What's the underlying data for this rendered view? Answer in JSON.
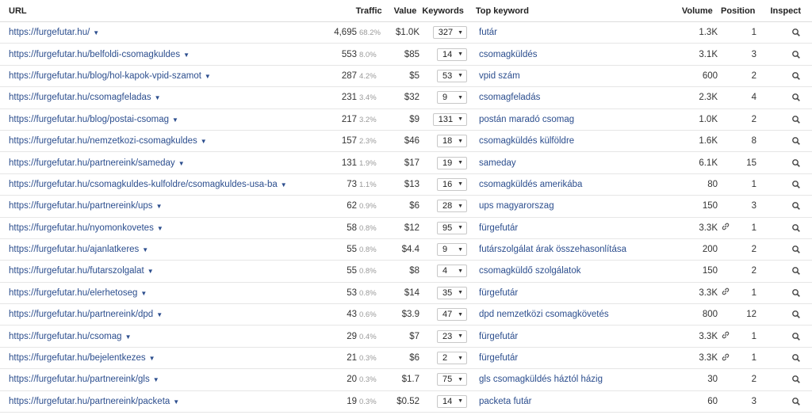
{
  "headers": {
    "url": "URL",
    "traffic": "Traffic",
    "value": "Value",
    "keywords": "Keywords",
    "top_keyword": "Top keyword",
    "volume": "Volume",
    "position": "Position",
    "inspect": "Inspect"
  },
  "rows": [
    {
      "url": "https://furgefutar.hu/",
      "traffic": "4,695",
      "share": "68.2%",
      "value": "$1.0K",
      "keywords": "327",
      "top_keyword": "futár",
      "volume": "1.3K",
      "link": false,
      "position": "1"
    },
    {
      "url": "https://furgefutar.hu/belfoldi-csomagkuldes",
      "traffic": "553",
      "share": "8.0%",
      "value": "$85",
      "keywords": "14",
      "top_keyword": "csomagküldés",
      "volume": "3.1K",
      "link": false,
      "position": "3"
    },
    {
      "url": "https://furgefutar.hu/blog/hol-kapok-vpid-szamot",
      "traffic": "287",
      "share": "4.2%",
      "value": "$5",
      "keywords": "53",
      "top_keyword": "vpid szám",
      "volume": "600",
      "link": false,
      "position": "2"
    },
    {
      "url": "https://furgefutar.hu/csomagfeladas",
      "traffic": "231",
      "share": "3.4%",
      "value": "$32",
      "keywords": "9",
      "top_keyword": "csomagfeladás",
      "volume": "2.3K",
      "link": false,
      "position": "4"
    },
    {
      "url": "https://furgefutar.hu/blog/postai-csomag",
      "traffic": "217",
      "share": "3.2%",
      "value": "$9",
      "keywords": "131",
      "top_keyword": "postán maradó csomag",
      "volume": "1.0K",
      "link": false,
      "position": "2"
    },
    {
      "url": "https://furgefutar.hu/nemzetkozi-csomagkuldes",
      "traffic": "157",
      "share": "2.3%",
      "value": "$46",
      "keywords": "18",
      "top_keyword": "csomagküldés külföldre",
      "volume": "1.6K",
      "link": false,
      "position": "8"
    },
    {
      "url": "https://furgefutar.hu/partnereink/sameday",
      "traffic": "131",
      "share": "1.9%",
      "value": "$17",
      "keywords": "19",
      "top_keyword": "sameday",
      "volume": "6.1K",
      "link": false,
      "position": "15"
    },
    {
      "url": "https://furgefutar.hu/csomagkuldes-kulfoldre/csomagkuldes-usa-ba",
      "traffic": "73",
      "share": "1.1%",
      "value": "$13",
      "keywords": "16",
      "top_keyword": "csomagküldés amerikába",
      "volume": "80",
      "link": false,
      "position": "1"
    },
    {
      "url": "https://furgefutar.hu/partnereink/ups",
      "traffic": "62",
      "share": "0.9%",
      "value": "$6",
      "keywords": "28",
      "top_keyword": "ups magyarorszag",
      "volume": "150",
      "link": false,
      "position": "3"
    },
    {
      "url": "https://furgefutar.hu/nyomonkovetes",
      "traffic": "58",
      "share": "0.8%",
      "value": "$12",
      "keywords": "95",
      "top_keyword": "fürgefutár",
      "volume": "3.3K",
      "link": true,
      "position": "1"
    },
    {
      "url": "https://furgefutar.hu/ajanlatkeres",
      "traffic": "55",
      "share": "0.8%",
      "value": "$4.4",
      "keywords": "9",
      "top_keyword": "futárszolgálat árak összehasonlítása",
      "volume": "200",
      "link": false,
      "position": "2"
    },
    {
      "url": "https://furgefutar.hu/futarszolgalat",
      "traffic": "55",
      "share": "0.8%",
      "value": "$8",
      "keywords": "4",
      "top_keyword": "csomagküldő szolgálatok",
      "volume": "150",
      "link": false,
      "position": "2"
    },
    {
      "url": "https://furgefutar.hu/elerhetoseg",
      "traffic": "53",
      "share": "0.8%",
      "value": "$14",
      "keywords": "35",
      "top_keyword": "fürgefutár",
      "volume": "3.3K",
      "link": true,
      "position": "1"
    },
    {
      "url": "https://furgefutar.hu/partnereink/dpd",
      "traffic": "43",
      "share": "0.6%",
      "value": "$3.9",
      "keywords": "47",
      "top_keyword": "dpd nemzetközi csomagkövetés",
      "volume": "800",
      "link": false,
      "position": "12"
    },
    {
      "url": "https://furgefutar.hu/csomag",
      "traffic": "29",
      "share": "0.4%",
      "value": "$7",
      "keywords": "23",
      "top_keyword": "fürgefutár",
      "volume": "3.3K",
      "link": true,
      "position": "1"
    },
    {
      "url": "https://furgefutar.hu/bejelentkezes",
      "traffic": "21",
      "share": "0.3%",
      "value": "$6",
      "keywords": "2",
      "top_keyword": "fürgefutár",
      "volume": "3.3K",
      "link": true,
      "position": "1"
    },
    {
      "url": "https://furgefutar.hu/partnereink/gls",
      "traffic": "20",
      "share": "0.3%",
      "value": "$1.7",
      "keywords": "75",
      "top_keyword": "gls csomagküldés háztól házig",
      "volume": "30",
      "link": false,
      "position": "2"
    },
    {
      "url": "https://furgefutar.hu/partnereink/packeta",
      "traffic": "19",
      "share": "0.3%",
      "value": "$0.52",
      "keywords": "14",
      "top_keyword": "packeta futár",
      "volume": "60",
      "link": false,
      "position": "3"
    }
  ],
  "icons": {
    "caret": "caret-down-icon",
    "link": "link-chain-icon",
    "inspect": "magnifier-icon"
  },
  "colors": {
    "link_text": "#2c4e8e",
    "muted": "#9a9a9a",
    "row_border": "#e6e6e6"
  }
}
